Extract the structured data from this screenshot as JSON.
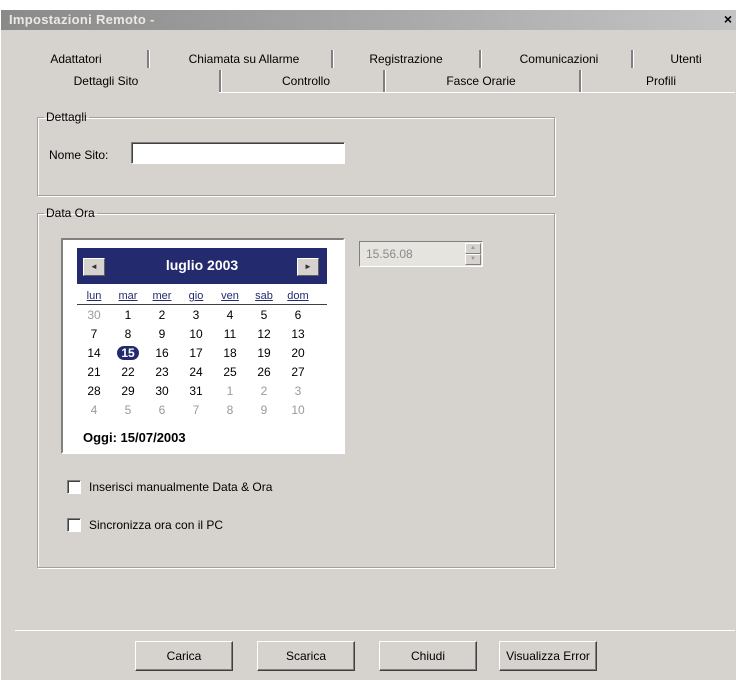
{
  "window": {
    "title": "Impostazioni Remoto -",
    "close_glyph": "×"
  },
  "tabs": {
    "row1": [
      "Adattatori",
      "Chiamata su Allarme",
      "Registrazione",
      "Comunicazioni",
      "Utenti"
    ],
    "row2": [
      "Dettagli Sito",
      "Controllo",
      "Fasce Orarie",
      "Profili"
    ],
    "active": "Dettagli Sito"
  },
  "dettagli": {
    "legend": "Dettagli",
    "site_name_label": "Nome Sito:",
    "site_name_value": ""
  },
  "dataora": {
    "legend": "Data Ora",
    "time_value": "15.56.08",
    "manual_checkbox_label": "Inserisci manualmente Data & Ora",
    "manual_checked": false,
    "sync_checkbox_label": "Sincronizza ora con il PC",
    "sync_checked": false
  },
  "calendar": {
    "month_label": "luglio 2003",
    "prev_icon": "◄",
    "next_icon": "►",
    "weekdays": [
      "lun",
      "mar",
      "mer",
      "gio",
      "ven",
      "sab",
      "dom"
    ],
    "weeks": [
      [
        {
          "d": "30",
          "o": true
        },
        {
          "d": "1"
        },
        {
          "d": "2"
        },
        {
          "d": "3"
        },
        {
          "d": "4"
        },
        {
          "d": "5"
        },
        {
          "d": "6"
        }
      ],
      [
        {
          "d": "7"
        },
        {
          "d": "8"
        },
        {
          "d": "9"
        },
        {
          "d": "10"
        },
        {
          "d": "11"
        },
        {
          "d": "12"
        },
        {
          "d": "13"
        }
      ],
      [
        {
          "d": "14"
        },
        {
          "d": "15",
          "s": true
        },
        {
          "d": "16"
        },
        {
          "d": "17"
        },
        {
          "d": "18"
        },
        {
          "d": "19"
        },
        {
          "d": "20"
        }
      ],
      [
        {
          "d": "21"
        },
        {
          "d": "22"
        },
        {
          "d": "23"
        },
        {
          "d": "24"
        },
        {
          "d": "25"
        },
        {
          "d": "26"
        },
        {
          "d": "27"
        }
      ],
      [
        {
          "d": "28"
        },
        {
          "d": "29"
        },
        {
          "d": "30"
        },
        {
          "d": "31"
        },
        {
          "d": "1",
          "o": true
        },
        {
          "d": "2",
          "o": true
        },
        {
          "d": "3",
          "o": true
        }
      ],
      [
        {
          "d": "4",
          "o": true
        },
        {
          "d": "5",
          "o": true
        },
        {
          "d": "6",
          "o": true
        },
        {
          "d": "7",
          "o": true
        },
        {
          "d": "8",
          "o": true
        },
        {
          "d": "9",
          "o": true
        },
        {
          "d": "10",
          "o": true
        }
      ]
    ],
    "today_label": "Oggi: 15/07/2003",
    "header_color": "#242a6e"
  },
  "buttons": {
    "carica": "Carica",
    "scarica": "Scarica",
    "chiudi": "Chiudi",
    "visualizza": "Visualizza Error"
  }
}
